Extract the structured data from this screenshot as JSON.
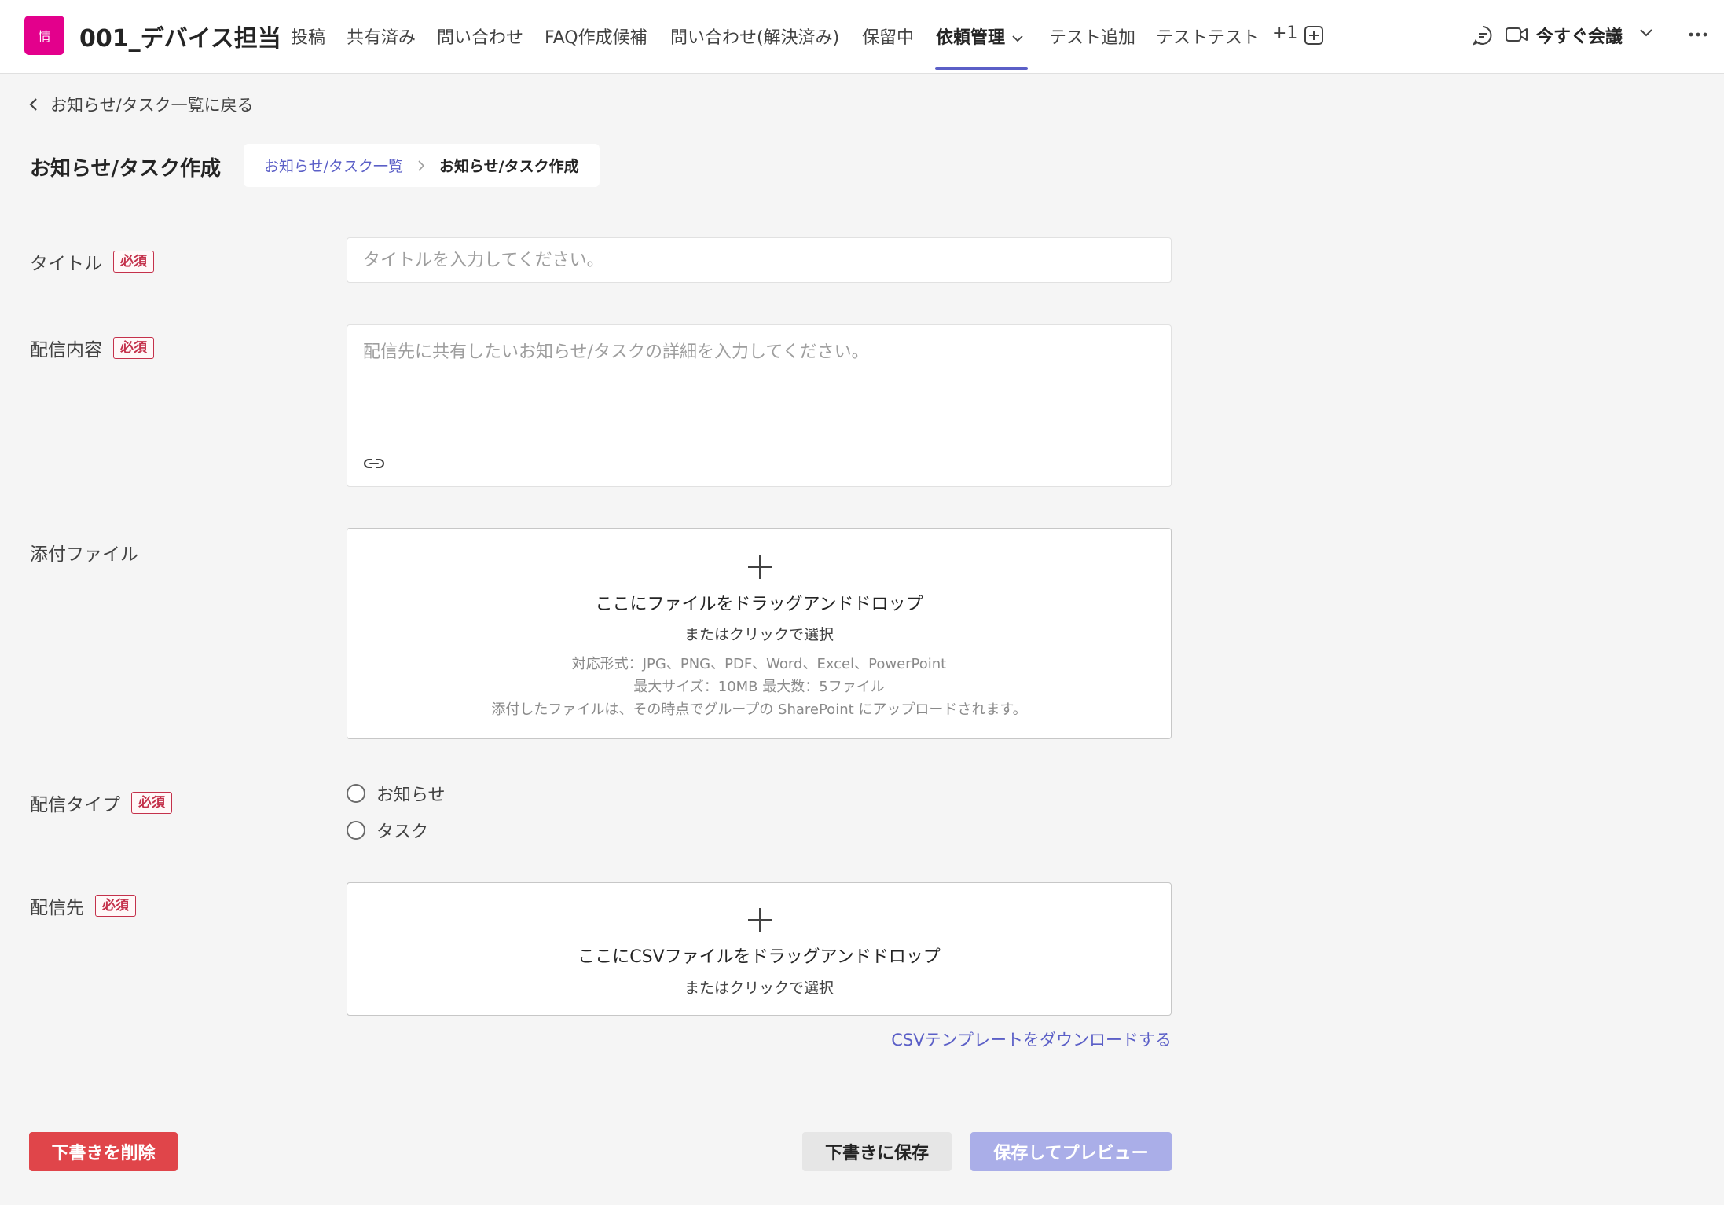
{
  "app": {
    "avatar_text": "情",
    "channel_title": "001_デバイス担当",
    "brand_color": "#e3008c",
    "accent_color": "#5b5fc7"
  },
  "tabs": [
    {
      "label": "投稿"
    },
    {
      "label": "共有済み"
    },
    {
      "label": "問い合わせ"
    },
    {
      "label": "FAQ作成候補"
    },
    {
      "label": "問い合わせ(解決済み)"
    },
    {
      "label": "保留中"
    },
    {
      "label": "依頼管理",
      "active": true
    },
    {
      "label": "テスト追加"
    },
    {
      "label": "テストテスト"
    },
    {
      "label": "+1"
    }
  ],
  "header_right": {
    "chat_icon": "chat-icon",
    "video_icon": "video-camera-icon",
    "meet_now_label": "今すぐ会議",
    "more_icon": "more-icon"
  },
  "back_link": "お知らせ/タスク一覧に戻る",
  "page_title": "お知らせ/タスク作成",
  "breadcrumb": {
    "parent": "お知らせ/タスク一覧",
    "current": "お知らせ/タスク作成"
  },
  "required_badge": "必須",
  "form": {
    "title": {
      "label": "タイトル",
      "placeholder": "タイトルを入力してください。",
      "value": ""
    },
    "content": {
      "label": "配信内容",
      "placeholder": "配信先に共有したいお知らせ/タスクの詳細を入力してください。",
      "value": ""
    },
    "attachments": {
      "label": "添付ファイル",
      "drop_text": "ここにファイルをドラッグアンドドロップ",
      "click_text": "またはクリックで選択",
      "formats": "対応形式：JPG、PNG、PDF、Word、Excel、PowerPoint",
      "limits": "最大サイズ：10MB 最大数：5ファイル",
      "note": "添付したファイルは、その時点でグループの SharePoint にアップロードされます。"
    },
    "delivery_type": {
      "label": "配信タイプ",
      "options": [
        "お知らせ",
        "タスク"
      ],
      "selected": null
    },
    "recipients": {
      "label": "配信先",
      "drop_text": "ここにCSVファイルをドラッグアンドドロップ",
      "click_text": "またはクリックで選択",
      "template_link": "CSVテンプレートをダウンロードする"
    }
  },
  "buttons": {
    "delete_draft": "下書きを削除",
    "save_draft": "下書きに保存",
    "save_preview": "保存してプレビュー"
  }
}
